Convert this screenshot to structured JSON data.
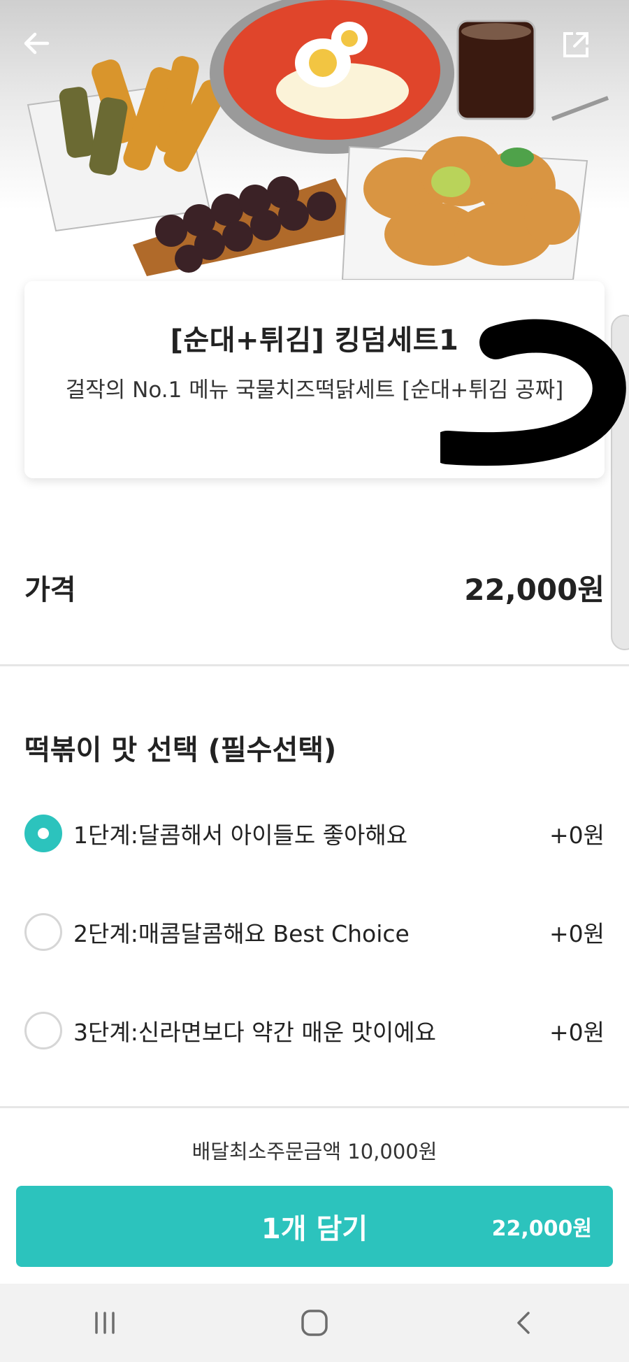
{
  "header": {
    "back_icon": "arrow-left-icon",
    "share_icon": "share-external-icon"
  },
  "product": {
    "name": "[순대+튀김] 킹덤세트1",
    "description": "걸작의 No.1 메뉴 국물치즈떡닭세트 [순대+튀김 공짜]"
  },
  "price": {
    "label": "가격",
    "value": "22,000원"
  },
  "options": {
    "title": "떡볶이 맛 선택 (필수선택)",
    "items": [
      {
        "label": "1단계:달콤해서 아이들도 좋아해요",
        "price": "+0원",
        "selected": true
      },
      {
        "label": "2단계:매콤달콤해요 Best Choice",
        "price": "+0원",
        "selected": false
      },
      {
        "label": "3단계:신라면보다 약간 매운 맛이에요",
        "price": "+0원",
        "selected": false
      }
    ]
  },
  "footer": {
    "min_order": "배달최소주문금액 10,000원",
    "cta_label": "1개 담기",
    "cta_total": "22,000원"
  },
  "colors": {
    "accent": "#2cc3bd",
    "text": "#222222",
    "divider": "#e6e6e6"
  },
  "navbar": {
    "icons": [
      "recent-apps-icon",
      "home-icon",
      "back-icon"
    ]
  }
}
